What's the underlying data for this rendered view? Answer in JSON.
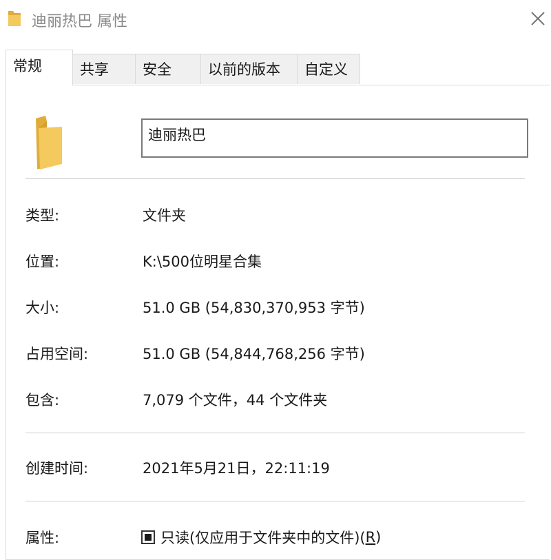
{
  "window": {
    "title": "迪丽热巴 属性",
    "icon": "folder-icon",
    "close_icon": "close-icon"
  },
  "tabs": [
    {
      "label": "常规",
      "active": true
    },
    {
      "label": "共享",
      "active": false
    },
    {
      "label": "安全",
      "active": false
    },
    {
      "label": "以前的版本",
      "active": false
    },
    {
      "label": "自定义",
      "active": false
    }
  ],
  "general": {
    "folder_name": "迪丽热巴",
    "rows": {
      "type": {
        "label": "类型:",
        "value": "文件夹"
      },
      "location": {
        "label": "位置:",
        "value": "K:\\500位明星合集"
      },
      "size": {
        "label": "大小:",
        "value": "51.0 GB (54,830,370,953 字节)"
      },
      "size_on_disk": {
        "label": "占用空间:",
        "value": "51.0 GB (54,844,768,256 字节)"
      },
      "contains": {
        "label": "包含:",
        "value": "7,079 个文件，44 个文件夹"
      },
      "created": {
        "label": "创建时间:",
        "value": "2021年5月21日，22:11:19"
      },
      "attributes": {
        "label": "属性:",
        "readonly_text": "只读(仅应用于文件夹中的文件)(",
        "readonly_key": "R",
        "readonly_close": ")",
        "readonly_state": "indeterminate"
      }
    }
  },
  "colors": {
    "folder": "#f4c95d",
    "folder_dark": "#e0ac3a",
    "tab_bg": "#f0f0f0",
    "border": "#d9d9d9"
  }
}
